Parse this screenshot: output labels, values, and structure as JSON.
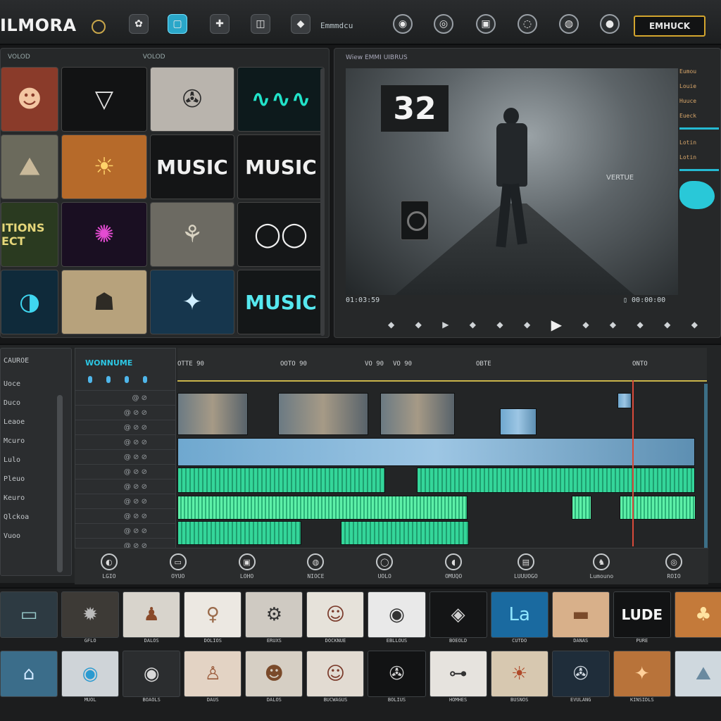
{
  "app": {
    "name": "ILMORA",
    "export_label": "EMHUCK",
    "toolbar_label": "Emmmdcu"
  },
  "toolbar_icons": [
    {
      "name": "palette-icon",
      "glyph": "✿"
    },
    {
      "name": "screen-icon",
      "glyph": "▢"
    },
    {
      "name": "puzzle-icon",
      "glyph": "✚"
    },
    {
      "name": "layers-icon",
      "glyph": "◫"
    },
    {
      "name": "diamond-icon",
      "glyph": "◆"
    },
    {
      "name": "record-icon",
      "glyph": "◉"
    },
    {
      "name": "target-icon",
      "glyph": "◎"
    },
    {
      "name": "lock-icon",
      "glyph": "▣"
    },
    {
      "name": "settings-icon",
      "glyph": "◌"
    },
    {
      "name": "focus-icon",
      "glyph": "◍"
    },
    {
      "name": "disc-icon",
      "glyph": "●"
    }
  ],
  "library": {
    "header_left": "VOLOD",
    "header_mid": "VOLOD",
    "thumbs": [
      {
        "label": "",
        "bg": "#8a3b2a",
        "fg": "#f3c6a2",
        "sym": "☻"
      },
      {
        "label": "",
        "bg": "#121314",
        "fg": "#e2e2e2",
        "sym": "▽"
      },
      {
        "label": "",
        "bg": "#b9b4ad",
        "fg": "#2c2c2c",
        "sym": "✇"
      },
      {
        "label": "",
        "bg": "#0d1a1c",
        "fg": "#21e2c8",
        "sym": "∿∿∿"
      },
      {
        "label": "",
        "bg": "#6b6a5c",
        "fg": "#c9b99a",
        "sym": "⛰"
      },
      {
        "label": "",
        "bg": "#b66a2a",
        "fg": "#ffd36a",
        "sym": "☀"
      },
      {
        "label": "MUSIC",
        "bg": "#141516",
        "fg": "#f0f0f0",
        "sym": ""
      },
      {
        "label": "MUSIC",
        "bg": "#141516",
        "fg": "#f0f0f0",
        "sym": ""
      },
      {
        "label": "ITIONS ECT",
        "bg": "#2a3a20",
        "fg": "#e5d67a",
        "sym": ""
      },
      {
        "label": "",
        "bg": "#1a0f22",
        "fg": "#e44bd2",
        "sym": "✺"
      },
      {
        "label": "",
        "bg": "#6c6a62",
        "fg": "#d9d3c2",
        "sym": "⚘"
      },
      {
        "label": "",
        "bg": "#151718",
        "fg": "#f0f0f0",
        "sym": "◯◯"
      },
      {
        "label": "",
        "bg": "#0f2a3a",
        "fg": "#3fd6f0",
        "sym": "◑"
      },
      {
        "label": "",
        "bg": "#b7a27c",
        "fg": "#2e2b25",
        "sym": "☗"
      },
      {
        "label": "",
        "bg": "#16364d",
        "fg": "#cfeeff",
        "sym": "✦"
      },
      {
        "label": "MUSIC",
        "bg": "#141718",
        "fg": "#56e8ef",
        "sym": ""
      }
    ]
  },
  "preview": {
    "title": "Wiew EMMI UIBRUS",
    "counter": "32",
    "overlay_text": "VERTUE",
    "timecode_left": "01:03:59",
    "timecode_right": "▯ 00:00:00",
    "side_labels": [
      "Eumou",
      "Louie",
      "Huuce",
      "Eueck",
      "Lotin",
      "Lotin"
    ],
    "transport": [
      "◆",
      "◆",
      "▶",
      "◆",
      "◆",
      "◆",
      "▶",
      "◆",
      "◆",
      "◆",
      "◆",
      "◆"
    ]
  },
  "timeline": {
    "left_header": "CAUROE",
    "left_items": [
      "Uoce",
      "Duco",
      "Leaoe",
      "Mcuro",
      "Lulo",
      "Pleuo",
      "Keuro",
      "Qlckoa",
      "Vuoo"
    ],
    "track_title": "WONNUME",
    "track_rows": [
      "@ ⊘",
      "@ ⊘ ⊘",
      "@ ⊘ ⊘",
      "@ ⊘ ⊘",
      "@ ⊘ ⊘",
      "@ ⊘ ⊘",
      "@ ⊘ ⊘",
      "@ ⊘ ⊘",
      "@ ⊘ ⊘",
      "@ ⊘ ⊘",
      "@ ⊘ ⊘"
    ],
    "ruler_marks": [
      "OTTE 90",
      "OOTO 90",
      "VO 90",
      "VO 90",
      "OBTE",
      "ONTO"
    ],
    "tools": [
      {
        "icon": "◐",
        "label": "LGIO",
        "name": "split-tool-icon"
      },
      {
        "icon": "▭",
        "label": "OYUO",
        "name": "crop-tool-icon"
      },
      {
        "icon": "▣",
        "label": "LOHO",
        "name": "frame-tool-icon"
      },
      {
        "icon": "◍",
        "label": "NIOCE",
        "name": "speed-tool-icon"
      },
      {
        "icon": "◯",
        "label": "UOLO",
        "name": "color-tool-icon"
      },
      {
        "icon": "◖",
        "label": "OMUQO",
        "name": "mask-tool-icon"
      },
      {
        "icon": "▤",
        "label": "LUUUOGO",
        "name": "audio-tool-icon"
      },
      {
        "icon": "♞",
        "label": "Lumouno",
        "name": "motion-tool-icon"
      },
      {
        "icon": "◎",
        "label": "ROIO",
        "name": "effects-tool-icon"
      }
    ]
  },
  "effects": {
    "row1": [
      {
        "label": "",
        "bg": "#2d3a42",
        "fg": "#9cc",
        "sym": "▭"
      },
      {
        "label": "GFLO",
        "bg": "#3d3a36",
        "fg": "#bbb",
        "sym": "✹"
      },
      {
        "label": "DALOS",
        "bg": "#d8d4cc",
        "fg": "#8a4a2a",
        "sym": "♟"
      },
      {
        "label": "DOLIOS",
        "bg": "#ece8e2",
        "fg": "#9a6a4a",
        "sym": "♀"
      },
      {
        "label": "ERUXS",
        "bg": "#cfcac2",
        "fg": "#333",
        "sym": "⚙"
      },
      {
        "label": "DOCKNUE",
        "bg": "#e6e2da",
        "fg": "#7a3a2a",
        "sym": "☺"
      },
      {
        "label": "EBLLOUS",
        "bg": "#e9e9e9",
        "fg": "#333",
        "sym": "◉"
      },
      {
        "label": "BOEOLD",
        "bg": "#141516",
        "fg": "#d0d0d0",
        "sym": "◈"
      },
      {
        "label": "CUTDO",
        "bg": "#1a6aa0",
        "fg": "#8fe6ff",
        "sym": "La"
      },
      {
        "label": "DANAS",
        "bg": "#d8b08a",
        "fg": "#7a4a2a",
        "sym": "▬"
      },
      {
        "label": "PURE",
        "bg": "#121314",
        "fg": "#f5f5f5",
        "sym": "LUDE"
      },
      {
        "label": "",
        "bg": "#c47a3a",
        "fg": "#ffe3a0",
        "sym": "♣"
      }
    ],
    "row2": [
      {
        "label": "",
        "bg": "#3b6d8a",
        "fg": "#d0e8ff",
        "sym": "⌂"
      },
      {
        "label": "MUOL",
        "bg": "#cfd4d8",
        "fg": "#2a9ad0",
        "sym": "◉"
      },
      {
        "label": "BOAOLS",
        "bg": "#2b2d2f",
        "fg": "#d8d8d8",
        "sym": "◉"
      },
      {
        "label": "DAUS",
        "bg": "#e3d3c4",
        "fg": "#9a5a3a",
        "sym": "♙"
      },
      {
        "label": "DALOS",
        "bg": "#d6cfc4",
        "fg": "#7a4a2a",
        "sym": "☻"
      },
      {
        "label": "BUCWAGUS",
        "bg": "#e2dbd2",
        "fg": "#7a3a2a",
        "sym": "☺"
      },
      {
        "label": "BOLIUS",
        "bg": "#121314",
        "fg": "#d0d0d0",
        "sym": "✇"
      },
      {
        "label": "HOMHES",
        "bg": "#e6e3de",
        "fg": "#333",
        "sym": "⊶"
      },
      {
        "label": "BUSNOS",
        "bg": "#d7c8b0",
        "fg": "#b04a2a",
        "sym": "☀"
      },
      {
        "label": "EVULANG",
        "bg": "#1f2d3a",
        "fg": "#d0d8e0",
        "sym": "✇"
      },
      {
        "label": "KINSIDLS",
        "bg": "#b8733a",
        "fg": "#ffd09a",
        "sym": "✦"
      },
      {
        "label": "",
        "bg": "#cfd8de",
        "fg": "#6a8aa0",
        "sym": "⛰"
      }
    ]
  }
}
